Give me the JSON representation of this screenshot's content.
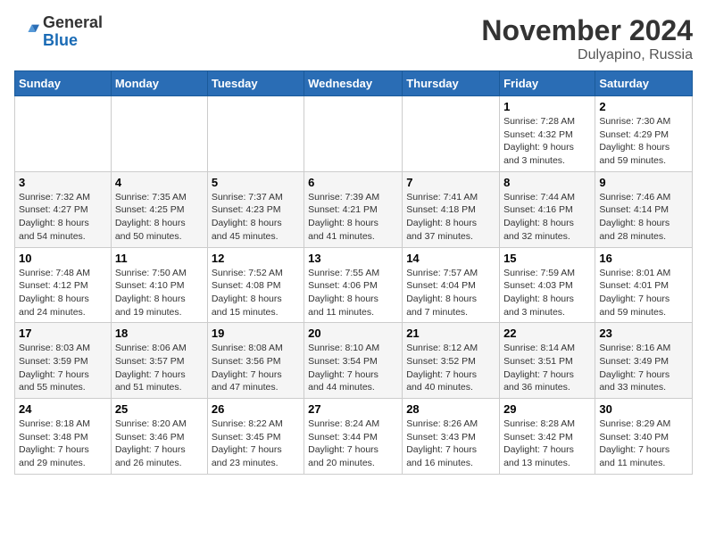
{
  "logo": {
    "general": "General",
    "blue": "Blue"
  },
  "title": "November 2024",
  "location": "Dulyapino, Russia",
  "days_of_week": [
    "Sunday",
    "Monday",
    "Tuesday",
    "Wednesday",
    "Thursday",
    "Friday",
    "Saturday"
  ],
  "weeks": [
    [
      {
        "day": "",
        "info": ""
      },
      {
        "day": "",
        "info": ""
      },
      {
        "day": "",
        "info": ""
      },
      {
        "day": "",
        "info": ""
      },
      {
        "day": "",
        "info": ""
      },
      {
        "day": "1",
        "info": "Sunrise: 7:28 AM\nSunset: 4:32 PM\nDaylight: 9 hours\nand 3 minutes."
      },
      {
        "day": "2",
        "info": "Sunrise: 7:30 AM\nSunset: 4:29 PM\nDaylight: 8 hours\nand 59 minutes."
      }
    ],
    [
      {
        "day": "3",
        "info": "Sunrise: 7:32 AM\nSunset: 4:27 PM\nDaylight: 8 hours\nand 54 minutes."
      },
      {
        "day": "4",
        "info": "Sunrise: 7:35 AM\nSunset: 4:25 PM\nDaylight: 8 hours\nand 50 minutes."
      },
      {
        "day": "5",
        "info": "Sunrise: 7:37 AM\nSunset: 4:23 PM\nDaylight: 8 hours\nand 45 minutes."
      },
      {
        "day": "6",
        "info": "Sunrise: 7:39 AM\nSunset: 4:21 PM\nDaylight: 8 hours\nand 41 minutes."
      },
      {
        "day": "7",
        "info": "Sunrise: 7:41 AM\nSunset: 4:18 PM\nDaylight: 8 hours\nand 37 minutes."
      },
      {
        "day": "8",
        "info": "Sunrise: 7:44 AM\nSunset: 4:16 PM\nDaylight: 8 hours\nand 32 minutes."
      },
      {
        "day": "9",
        "info": "Sunrise: 7:46 AM\nSunset: 4:14 PM\nDaylight: 8 hours\nand 28 minutes."
      }
    ],
    [
      {
        "day": "10",
        "info": "Sunrise: 7:48 AM\nSunset: 4:12 PM\nDaylight: 8 hours\nand 24 minutes."
      },
      {
        "day": "11",
        "info": "Sunrise: 7:50 AM\nSunset: 4:10 PM\nDaylight: 8 hours\nand 19 minutes."
      },
      {
        "day": "12",
        "info": "Sunrise: 7:52 AM\nSunset: 4:08 PM\nDaylight: 8 hours\nand 15 minutes."
      },
      {
        "day": "13",
        "info": "Sunrise: 7:55 AM\nSunset: 4:06 PM\nDaylight: 8 hours\nand 11 minutes."
      },
      {
        "day": "14",
        "info": "Sunrise: 7:57 AM\nSunset: 4:04 PM\nDaylight: 8 hours\nand 7 minutes."
      },
      {
        "day": "15",
        "info": "Sunrise: 7:59 AM\nSunset: 4:03 PM\nDaylight: 8 hours\nand 3 minutes."
      },
      {
        "day": "16",
        "info": "Sunrise: 8:01 AM\nSunset: 4:01 PM\nDaylight: 7 hours\nand 59 minutes."
      }
    ],
    [
      {
        "day": "17",
        "info": "Sunrise: 8:03 AM\nSunset: 3:59 PM\nDaylight: 7 hours\nand 55 minutes."
      },
      {
        "day": "18",
        "info": "Sunrise: 8:06 AM\nSunset: 3:57 PM\nDaylight: 7 hours\nand 51 minutes."
      },
      {
        "day": "19",
        "info": "Sunrise: 8:08 AM\nSunset: 3:56 PM\nDaylight: 7 hours\nand 47 minutes."
      },
      {
        "day": "20",
        "info": "Sunrise: 8:10 AM\nSunset: 3:54 PM\nDaylight: 7 hours\nand 44 minutes."
      },
      {
        "day": "21",
        "info": "Sunrise: 8:12 AM\nSunset: 3:52 PM\nDaylight: 7 hours\nand 40 minutes."
      },
      {
        "day": "22",
        "info": "Sunrise: 8:14 AM\nSunset: 3:51 PM\nDaylight: 7 hours\nand 36 minutes."
      },
      {
        "day": "23",
        "info": "Sunrise: 8:16 AM\nSunset: 3:49 PM\nDaylight: 7 hours\nand 33 minutes."
      }
    ],
    [
      {
        "day": "24",
        "info": "Sunrise: 8:18 AM\nSunset: 3:48 PM\nDaylight: 7 hours\nand 29 minutes."
      },
      {
        "day": "25",
        "info": "Sunrise: 8:20 AM\nSunset: 3:46 PM\nDaylight: 7 hours\nand 26 minutes."
      },
      {
        "day": "26",
        "info": "Sunrise: 8:22 AM\nSunset: 3:45 PM\nDaylight: 7 hours\nand 23 minutes."
      },
      {
        "day": "27",
        "info": "Sunrise: 8:24 AM\nSunset: 3:44 PM\nDaylight: 7 hours\nand 20 minutes."
      },
      {
        "day": "28",
        "info": "Sunrise: 8:26 AM\nSunset: 3:43 PM\nDaylight: 7 hours\nand 16 minutes."
      },
      {
        "day": "29",
        "info": "Sunrise: 8:28 AM\nSunset: 3:42 PM\nDaylight: 7 hours\nand 13 minutes."
      },
      {
        "day": "30",
        "info": "Sunrise: 8:29 AM\nSunset: 3:40 PM\nDaylight: 7 hours\nand 11 minutes."
      }
    ]
  ]
}
